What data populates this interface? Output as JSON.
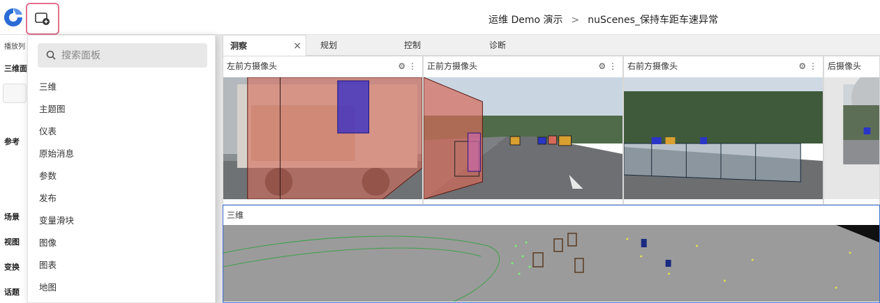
{
  "header": {
    "breadcrumb": [
      "运维 Demo 演示",
      "nuScenes_保持车距车速异常"
    ],
    "breadcrumb_separator": ">"
  },
  "sidebar": {
    "top_label": "播放列",
    "items": [
      "三维面",
      "参考",
      "场景",
      "视图",
      "变换",
      "话题"
    ]
  },
  "add_panel_menu": {
    "search_placeholder": "搜索面板",
    "items": [
      "三维",
      "主题图",
      "仪表",
      "原始消息",
      "参数",
      "发布",
      "变量滑块",
      "图像",
      "图表",
      "地图"
    ]
  },
  "tabs": [
    {
      "label": "洞察",
      "active": true
    },
    {
      "label": "规划",
      "active": false
    },
    {
      "label": "控制",
      "active": false
    },
    {
      "label": "诊断",
      "active": false
    }
  ],
  "panels": {
    "cam_front_left": "左前方摄像头",
    "cam_front": "正前方摄像头",
    "cam_front_right": "右前方摄像头",
    "cam_back": "后摄像头",
    "three_d": "三维"
  },
  "tab_close_glyph": "×",
  "colors": {
    "accent_highlight": "#e2708d",
    "active_panel_border": "#3b6fd4",
    "logo": "#2a6bd6"
  }
}
